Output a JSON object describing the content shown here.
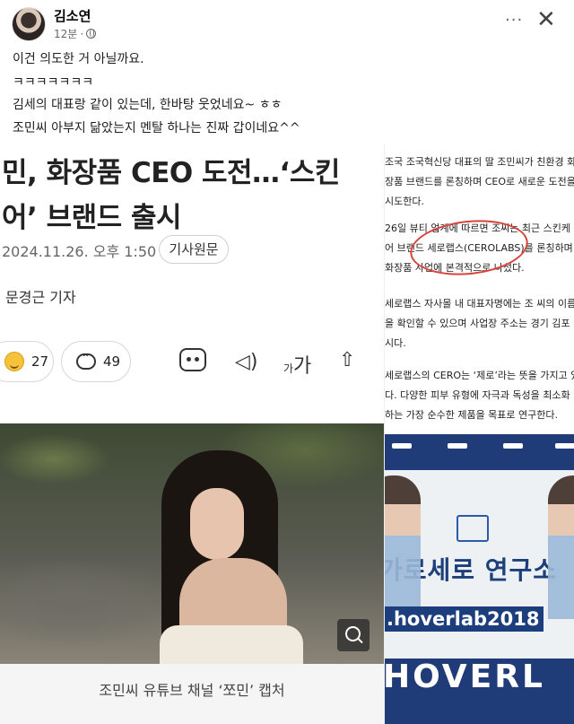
{
  "post": {
    "author": "김소연",
    "time": "12분",
    "dot": "·",
    "more_label": "···",
    "close_label": "✕",
    "lines": [
      "이건 의도한 거 아닐까요.",
      "ㅋㅋㅋㅋㅋㅋㅋ",
      "김세의 대표랑 같이 있는데, 한바탕 웃었네요~ ㅎㅎ",
      "조민씨 아부지 닮았는지 멘탈 하나는  진짜 갑이네요^^"
    ]
  },
  "article": {
    "headline_1": "민, 화장품 CEO 도전…‘스킨",
    "headline_2": "어’ 브랜드 출시",
    "date": "2024.11.26. 오후 1:50",
    "source_button": "기사원문",
    "reporter": "문경근 기자",
    "like_count": "27",
    "comment_count": "49",
    "speaker_icon": "◁)",
    "font_small": "가",
    "font_large": "가",
    "share_icon": "⇧",
    "caption": "조민씨 유튜브 채널 ‘쪼민’ 캡처"
  },
  "right_article": {
    "paragraphs": [
      "조국 조국혁신당 대표의 딸 조민씨가 친환경 화",
      "장품 브랜드를 론칭하며 CEO로 새로운 도전을",
      "시도한다.",
      "26일 뷰티 업계에 따르면 조씨는 최근 스킨케",
      "어 브랜드 세로랩스(CEROLABS)를 론칭하며",
      "화장품 사업에 본격적으로 나섰다.",
      "세로랩스 자사몰 내 대표자명에는 조 씨의 이름",
      "을 확인할 수 있으며 사업장 주소는 경기 김포",
      "시다.",
      "세로랩스의 CERO는 ‘제로’라는 뜻을 가지고 있",
      "다. 다양한 피부 유형에 자극과 독성을 최소화",
      "하는 가장 순수한 제품을 목표로 연구한다."
    ],
    "banner_text": "가로세로 연구소",
    "url_text": ".hoverlab2018",
    "big_text": "HOVERL"
  },
  "colors": {
    "accent_red": "#d8433a",
    "banner_blue": "#1d3f7a"
  }
}
